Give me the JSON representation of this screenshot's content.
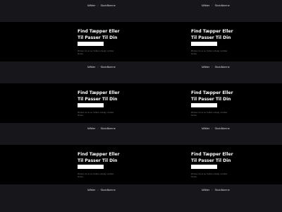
{
  "nav": {
    "link_1": "Måtter",
    "link_2": "Skobåkerne"
  },
  "hero": {
    "title": "Find Tæpper Eller Til Passer Til Din Bil",
    "input_value": "",
    "description": "Ønsker du at se hvilket udvalg i artikler findes"
  },
  "colors": {
    "background": "#000000",
    "bar": "#16161b",
    "title": "#ffffff",
    "description": "#6f6f75"
  }
}
